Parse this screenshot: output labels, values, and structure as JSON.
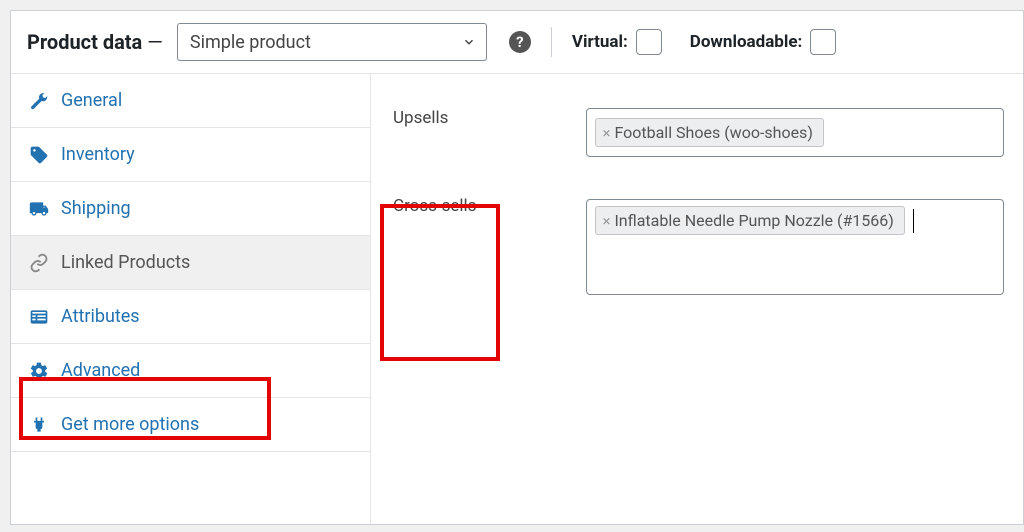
{
  "header": {
    "title": "Product data",
    "product_type": "Simple product",
    "virtual_label": "Virtual:",
    "downloadable_label": "Downloadable:"
  },
  "tabs": [
    {
      "label": "General"
    },
    {
      "label": "Inventory"
    },
    {
      "label": "Shipping"
    },
    {
      "label": "Linked Products"
    },
    {
      "label": "Attributes"
    },
    {
      "label": "Advanced"
    },
    {
      "label": "Get more options"
    }
  ],
  "fields": {
    "upsells_label": "Upsells",
    "cross_sells_label": "Cross-sells",
    "upsells_tag": "Football Shoes (woo-shoes)",
    "cross_sells_tag": "Inflatable Needle Pump Nozzle (#1566)"
  }
}
